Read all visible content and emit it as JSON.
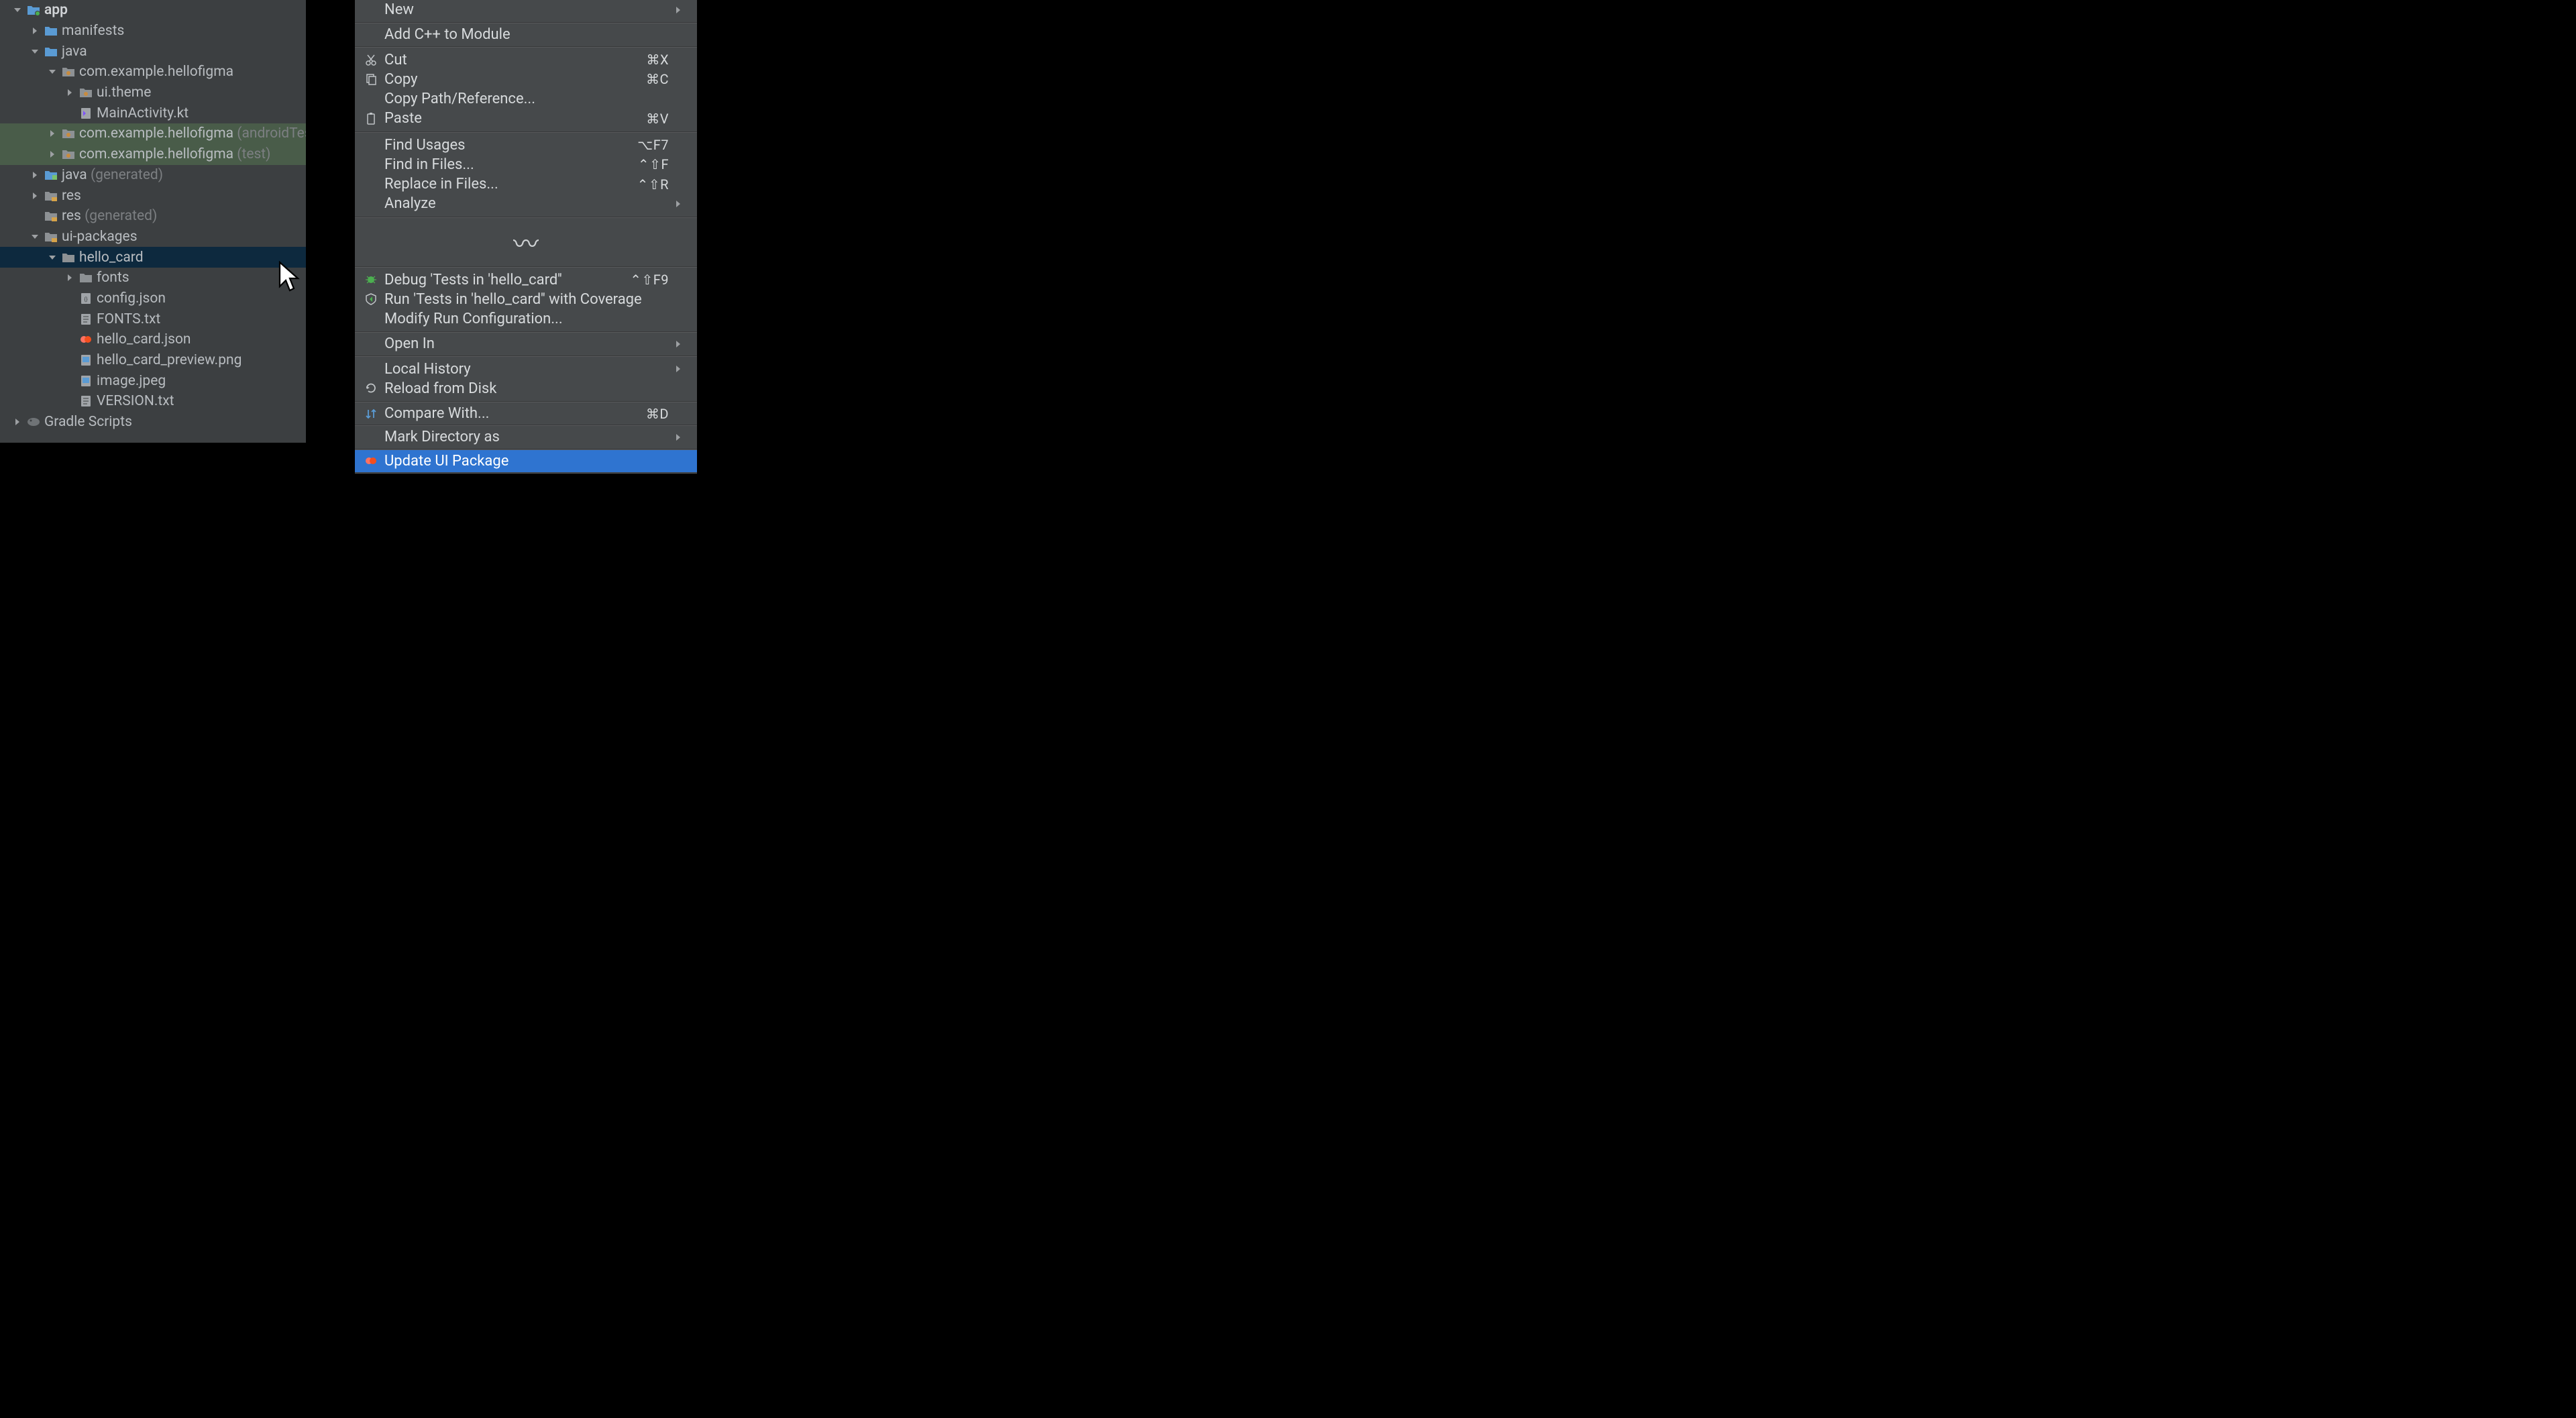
{
  "tree": [
    {
      "indent": 0,
      "chev": "down",
      "icon": "module",
      "label": "app",
      "bold": true
    },
    {
      "indent": 1,
      "chev": "right",
      "icon": "folder",
      "label": "manifests"
    },
    {
      "indent": 1,
      "chev": "down",
      "icon": "folder",
      "label": "java"
    },
    {
      "indent": 2,
      "chev": "down",
      "icon": "package",
      "label": "com.example.hellofigma"
    },
    {
      "indent": 3,
      "chev": "right",
      "icon": "package",
      "label": "ui.theme"
    },
    {
      "indent": 3,
      "chev": "none",
      "icon": "ktfile",
      "label": "MainActivity.kt"
    },
    {
      "indent": 2,
      "chev": "right",
      "icon": "package",
      "label": "com.example.hellofigma",
      "dim": " (androidTest)",
      "hl": 1
    },
    {
      "indent": 2,
      "chev": "right",
      "icon": "package",
      "label": "com.example.hellofigma",
      "dim": " (test)",
      "hl": 1
    },
    {
      "indent": 1,
      "chev": "right",
      "icon": "genfolder",
      "label": "java",
      "dim": " (generated)"
    },
    {
      "indent": 1,
      "chev": "right",
      "icon": "resfolder",
      "label": "res"
    },
    {
      "indent": 1,
      "chev": "none",
      "icon": "resfolder",
      "label": "res",
      "dim": " (generated)"
    },
    {
      "indent": 1,
      "chev": "down",
      "icon": "resfolder",
      "label": "ui-packages"
    },
    {
      "indent": 2,
      "chev": "down",
      "icon": "folder-grey",
      "label": "hello_card",
      "selected": true
    },
    {
      "indent": 3,
      "chev": "right",
      "icon": "folder-grey",
      "label": "fonts"
    },
    {
      "indent": 3,
      "chev": "none",
      "icon": "jsonfile",
      "label": "config.json"
    },
    {
      "indent": 3,
      "chev": "none",
      "icon": "txtfile",
      "label": "FONTS.txt"
    },
    {
      "indent": 3,
      "chev": "none",
      "icon": "figma",
      "label": "hello_card.json"
    },
    {
      "indent": 3,
      "chev": "none",
      "icon": "imgfile",
      "label": "hello_card_preview.png"
    },
    {
      "indent": 3,
      "chev": "none",
      "icon": "imgfile",
      "label": "image.jpeg"
    },
    {
      "indent": 3,
      "chev": "none",
      "icon": "txtfile",
      "label": "VERSION.txt"
    },
    {
      "indent": 0,
      "chev": "right",
      "icon": "gradle",
      "label": "Gradle Scripts"
    }
  ],
  "menu": [
    {
      "type": "item",
      "label": "New",
      "sub": true
    },
    {
      "type": "sep"
    },
    {
      "type": "item",
      "label": "Add C++ to Module"
    },
    {
      "type": "sep"
    },
    {
      "type": "item",
      "icon": "cut",
      "label": "Cut",
      "shortcut": "⌘X"
    },
    {
      "type": "item",
      "icon": "copy",
      "label": "Copy",
      "shortcut": "⌘C"
    },
    {
      "type": "item",
      "label": "Copy Path/Reference..."
    },
    {
      "type": "item",
      "icon": "paste",
      "label": "Paste",
      "shortcut": "⌘V"
    },
    {
      "type": "sep"
    },
    {
      "type": "item",
      "label": "Find Usages",
      "shortcut": "⌥F7"
    },
    {
      "type": "item",
      "label": "Find in Files...",
      "shortcut": "⌃⇧F"
    },
    {
      "type": "item",
      "label": "Replace in Files...",
      "shortcut": "⌃⇧R"
    },
    {
      "type": "item",
      "label": "Analyze",
      "sub": true
    },
    {
      "type": "sep"
    },
    {
      "type": "gap"
    },
    {
      "type": "sep"
    },
    {
      "type": "item",
      "icon": "bug",
      "label": "Debug 'Tests in 'hello_card''",
      "shortcut": "⌃⇧F9"
    },
    {
      "type": "item",
      "icon": "cov",
      "label": "Run 'Tests in 'hello_card'' with Coverage"
    },
    {
      "type": "item",
      "label": "Modify Run Configuration..."
    },
    {
      "type": "sep"
    },
    {
      "type": "item",
      "label": "Open In",
      "sub": true
    },
    {
      "type": "sep"
    },
    {
      "type": "item",
      "label": "Local History",
      "sub": true
    },
    {
      "type": "item",
      "icon": "reload",
      "label": "Reload from Disk"
    },
    {
      "type": "sep"
    },
    {
      "type": "item",
      "icon": "diff",
      "label": "Compare With...",
      "shortcut": "⌘D"
    },
    {
      "type": "sep"
    },
    {
      "type": "item",
      "label": "Mark Directory as",
      "sub": true
    },
    {
      "type": "sep"
    },
    {
      "type": "item",
      "icon": "figma",
      "label": "Update UI Package",
      "selected": true
    },
    {
      "type": "sep"
    }
  ]
}
